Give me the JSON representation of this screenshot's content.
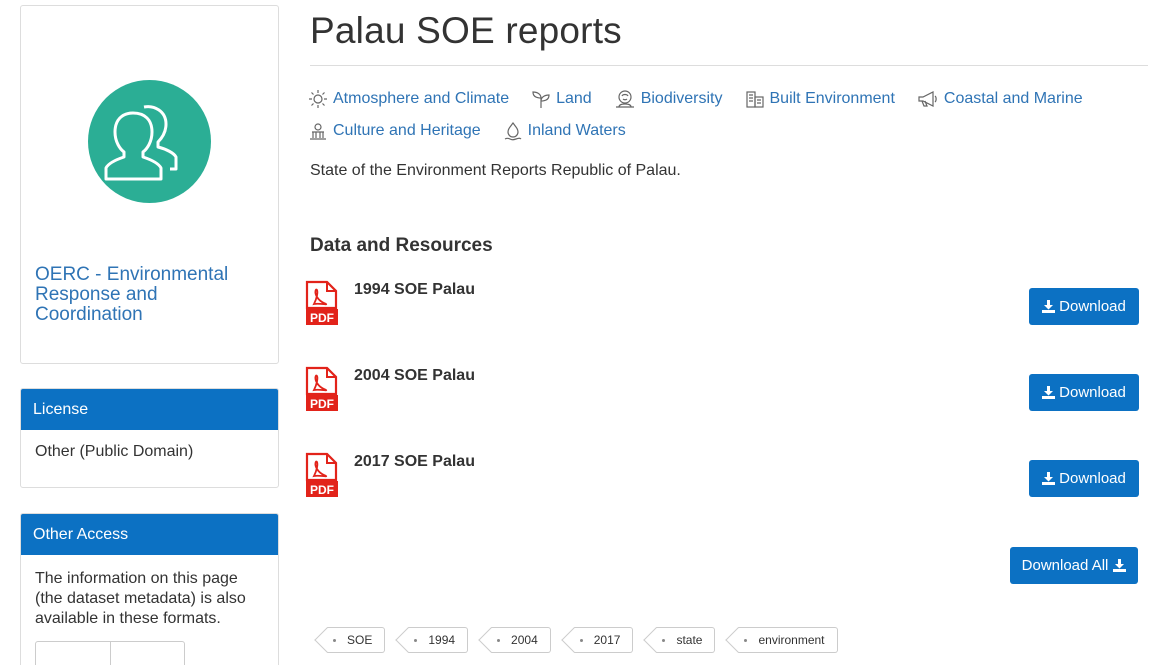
{
  "organization": {
    "name": "OERC - Environmental Response and Coordination",
    "avatar_color": "#2bae95",
    "avatar_icon": "user-group-icon"
  },
  "license": {
    "heading": "License",
    "value": "Other (Public Domain)"
  },
  "other_access": {
    "heading": "Other Access",
    "text": "The information on this page (the dataset metadata) is also available in these formats."
  },
  "dataset": {
    "title": "Palau SOE reports",
    "description": "State of the Environment Reports Republic of Palau.",
    "topics": [
      {
        "label": "Atmosphere and Climate",
        "icon": "climate-icon"
      },
      {
        "label": "Land",
        "icon": "land-icon"
      },
      {
        "label": "Biodiversity",
        "icon": "biodiversity-icon"
      },
      {
        "label": "Built Environment",
        "icon": "building-icon"
      },
      {
        "label": "Coastal and Marine",
        "icon": "megaphone-icon"
      },
      {
        "label": "Culture and Heritage",
        "icon": "heritage-icon"
      },
      {
        "label": "Inland Waters",
        "icon": "water-icon"
      }
    ]
  },
  "resources": {
    "heading": "Data and Resources",
    "download_label": "Download",
    "download_all_label": "Download All",
    "items": [
      {
        "name": "1994 SOE Palau",
        "format": "PDF"
      },
      {
        "name": "2004 SOE Palau",
        "format": "PDF"
      },
      {
        "name": "2017 SOE Palau",
        "format": "PDF"
      }
    ]
  },
  "tags": [
    "SOE",
    "1994",
    "2004",
    "2017",
    "state",
    "environment"
  ],
  "colors": {
    "primary": "#0c71c3",
    "link": "#2f74b5",
    "pdf_red": "#e2231a"
  }
}
